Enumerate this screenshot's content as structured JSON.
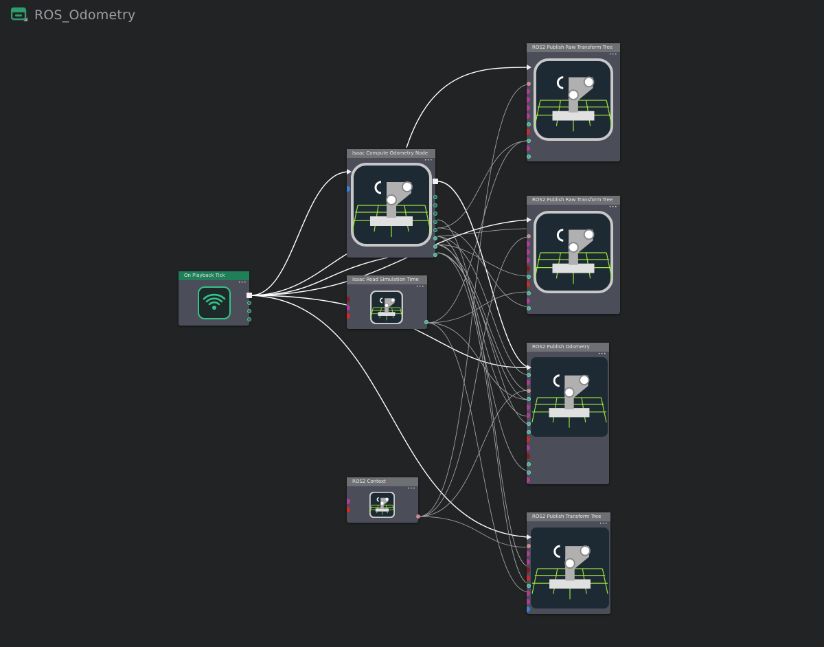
{
  "graph": {
    "title": "ROS_Odometry",
    "icon": "action-graph-icon",
    "accent": "#2f9c6e"
  },
  "nodes": {
    "on_playback_tick": {
      "title": "On Playback Tick",
      "icon": "signal-broadcast-icon",
      "header_color": "#1f7f59"
    },
    "compute_odometry": {
      "title": "Isaac Compute Odometry Node",
      "icon": "robot-arm-icon"
    },
    "read_sim_time": {
      "title": "Isaac Read Simulation Time",
      "icon": "robot-arm-icon"
    },
    "ros2_context": {
      "title": "ROS2 Context",
      "icon": "robot-arm-icon"
    },
    "publish_raw_tf_1": {
      "title": "ROS2 Publish Raw Transform Tree",
      "icon": "robot-arm-icon"
    },
    "publish_raw_tf_2": {
      "title": "ROS2 Publish Raw Transform Tree",
      "icon": "robot-arm-icon"
    },
    "publish_odometry": {
      "title": "ROS2 Publish Odometry",
      "icon": "robot-arm-icon"
    },
    "publish_tf": {
      "title": "ROS2 Publish Transform Tree",
      "icon": "robot-arm-icon"
    }
  },
  "colors": {
    "background": "#222324",
    "node_body": "#4b4d59",
    "node_header": "#6e7074",
    "wire": "#bfbfbf",
    "exec_wire": "#ffffff",
    "robot_icon_bg": "#1e2a33",
    "robot_grid": "#9ce83a"
  }
}
